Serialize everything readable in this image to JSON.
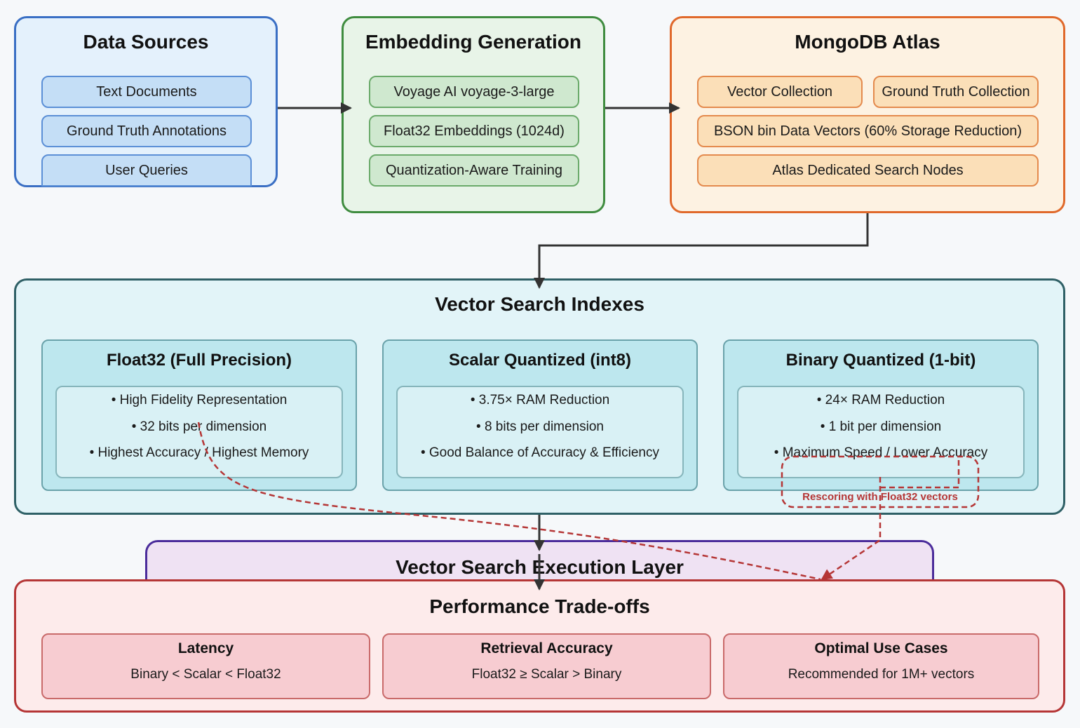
{
  "data_sources": {
    "title": "Data Sources",
    "items": [
      "Text Documents",
      "Ground Truth Annotations",
      "User Queries"
    ]
  },
  "embedding_generation": {
    "title": "Embedding Generation",
    "items": [
      "Voyage AI voyage-3-large",
      "Float32 Embeddings (1024d)",
      "Quantization-Aware Training"
    ]
  },
  "mongodb_atlas": {
    "title": "MongoDB Atlas",
    "items": [
      "Vector Collection",
      "Ground Truth Collection",
      "BSON bin Data Vectors (60% Storage Reduction)",
      "Atlas Dedicated Search Nodes"
    ]
  },
  "vector_search_indexes": {
    "title": "Vector Search Indexes",
    "indexes": [
      {
        "title": "Float32 (Full Precision)",
        "bullets": [
          "• High Fidelity Representation",
          "• 32 bits per dimension",
          "• Highest Accuracy / Highest Memory"
        ]
      },
      {
        "title": "Scalar Quantized (int8)",
        "bullets": [
          "• 3.75× RAM Reduction",
          "• 8 bits per dimension",
          "• Good Balance of Accuracy & Efficiency"
        ]
      },
      {
        "title": "Binary Quantized (1-bit)",
        "bullets": [
          "• 24× RAM Reduction",
          "• 1 bit per dimension",
          "• Maximum Speed / Lower Accuracy"
        ]
      }
    ],
    "rescoring_label": "Rescoring with Float32 vectors"
  },
  "execution_layer": {
    "title": "Vector Search Execution Layer"
  },
  "performance_tradeoffs": {
    "title": "Performance Trade-offs",
    "boxes": [
      {
        "title": "Latency",
        "desc": "Binary < Scalar < Float32"
      },
      {
        "title": "Retrieval Accuracy",
        "desc": "Float32 ≥ Scalar > Binary"
      },
      {
        "title": "Optimal Use Cases",
        "desc": "Recommended for 1M+ vectors"
      }
    ]
  },
  "colors": {
    "connector": "#333333",
    "rescoring": "#b53636"
  }
}
